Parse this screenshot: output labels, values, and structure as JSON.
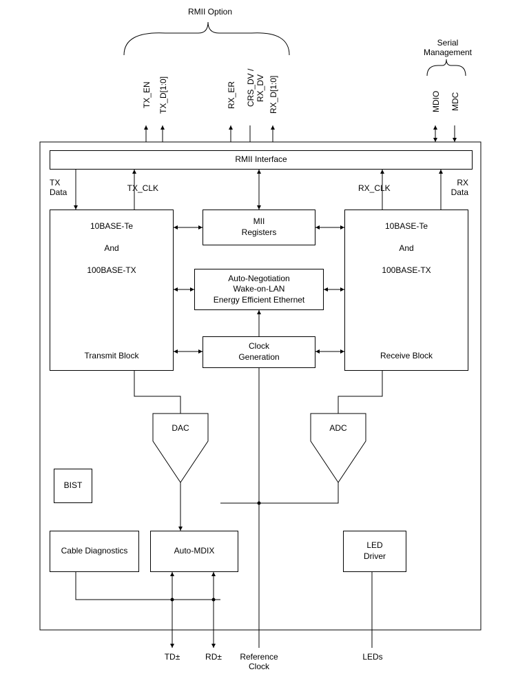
{
  "top_groups": {
    "rmii_option": "RMII Option",
    "serial_management": "Serial\nManagement"
  },
  "signals": {
    "tx_en": "TX_EN",
    "tx_d": "TX_D[1:0]",
    "rx_er": "RX_ER",
    "crs_dv": "CRS_DV / RX_DV",
    "rx_d": "RX_D[1:0]",
    "mdio": "MDIO",
    "mdc": "MDC"
  },
  "internal_labels": {
    "tx_data": "TX\nData",
    "tx_clk": "TX_CLK",
    "rx_clk": "RX_CLK",
    "rx_data": "RX\nData"
  },
  "blocks": {
    "rmii_interface": "RMII Interface",
    "tx_block_line1": "10BASE-Te",
    "tx_block_line2": "And",
    "tx_block_line3": "100BASE-TX",
    "tx_block_line4": "Transmit Block",
    "rx_block_line1": "10BASE-Te",
    "rx_block_line2": "And",
    "rx_block_line3": "100BASE-TX",
    "rx_block_line4": "Receive Block",
    "mii_registers": "MII\nRegisters",
    "anwoleee": "Auto-Negotiation\nWake-on-LAN\nEnergy Efficient Ethernet",
    "clock_gen": "Clock\nGeneration",
    "dac": "DAC",
    "adc": "ADC",
    "bist": "BIST",
    "cable_diag": "Cable Diagnostics",
    "auto_mdix": "Auto-MDIX",
    "led_driver": "LED\nDriver"
  },
  "bottom_labels": {
    "td": "TD±",
    "rd": "RD±",
    "ref_clock": "Reference\nClock",
    "leds": "LEDs"
  }
}
